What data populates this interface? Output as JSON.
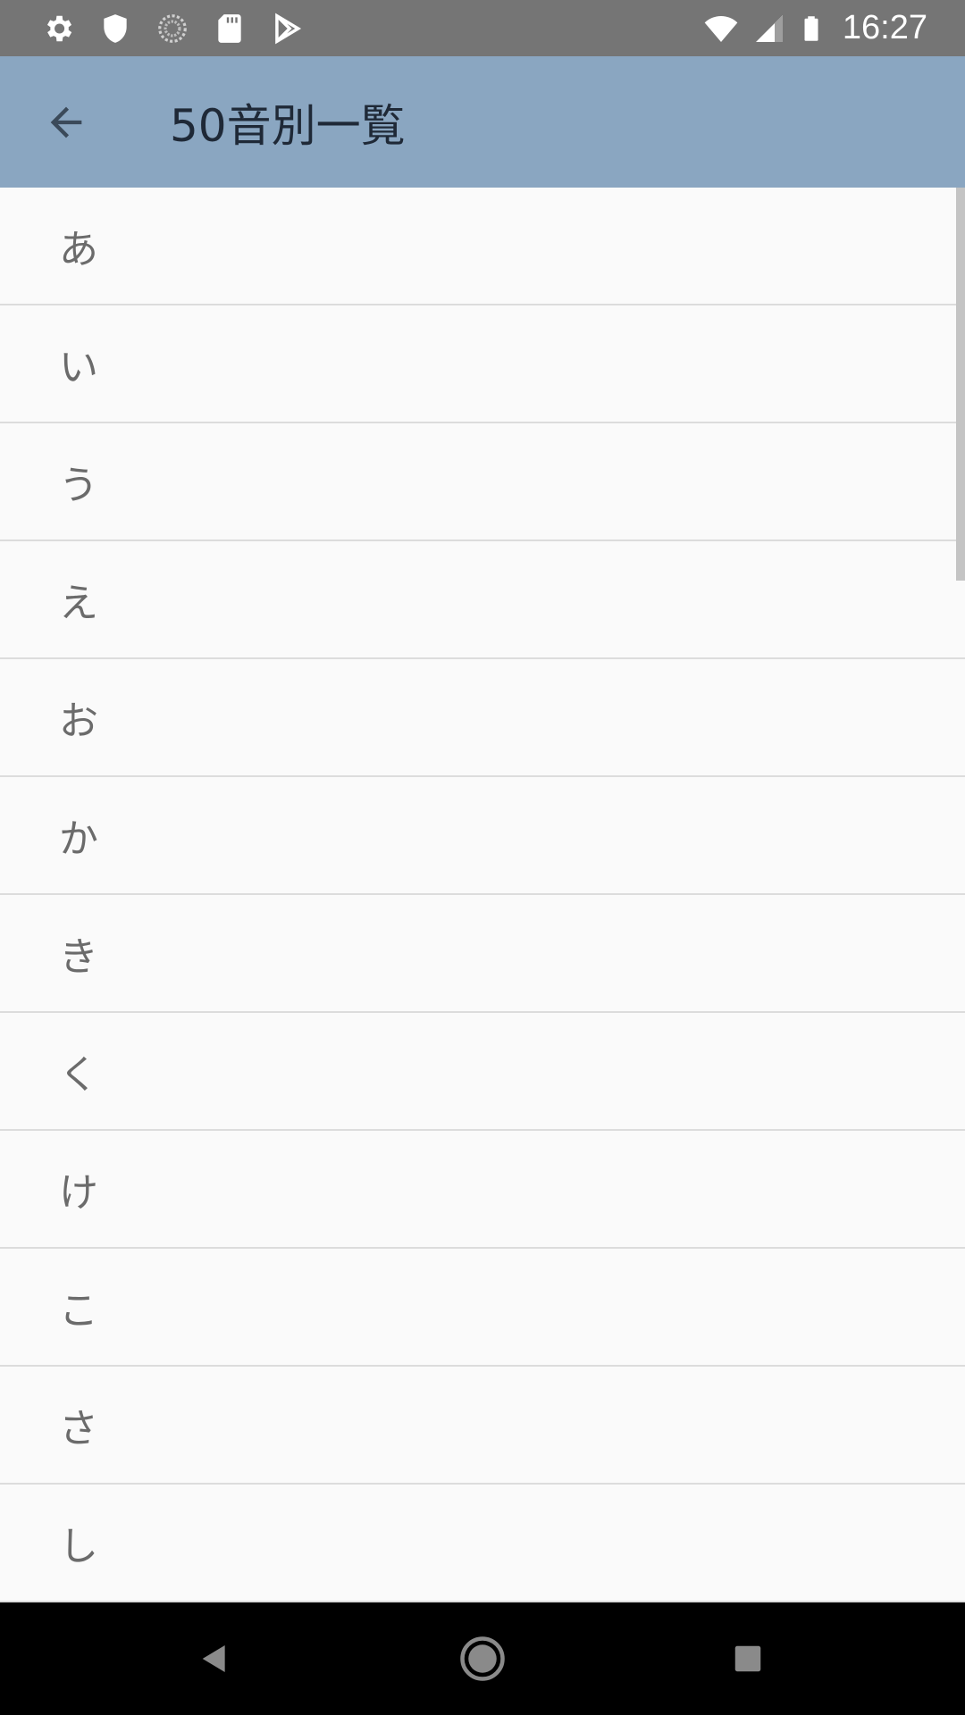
{
  "status_bar": {
    "time": "16:27",
    "left_icons": [
      "settings-icon",
      "shield-icon",
      "sync-icon",
      "sd-card-icon",
      "play-store-icon"
    ],
    "right_icons": [
      "wifi-icon",
      "signal-icon",
      "battery-icon"
    ]
  },
  "app_bar": {
    "title": "50音別一覧",
    "back_icon": "arrow-back-icon",
    "background": "#8aa6c1"
  },
  "list": {
    "items": [
      {
        "label": "あ"
      },
      {
        "label": "い"
      },
      {
        "label": "う"
      },
      {
        "label": "え"
      },
      {
        "label": "お"
      },
      {
        "label": "か"
      },
      {
        "label": "き"
      },
      {
        "label": "く"
      },
      {
        "label": "け"
      },
      {
        "label": "こ"
      },
      {
        "label": "さ"
      },
      {
        "label": "し"
      }
    ]
  },
  "nav_bar": {
    "icons": [
      "nav-back-icon",
      "nav-home-icon",
      "nav-recents-icon"
    ]
  }
}
